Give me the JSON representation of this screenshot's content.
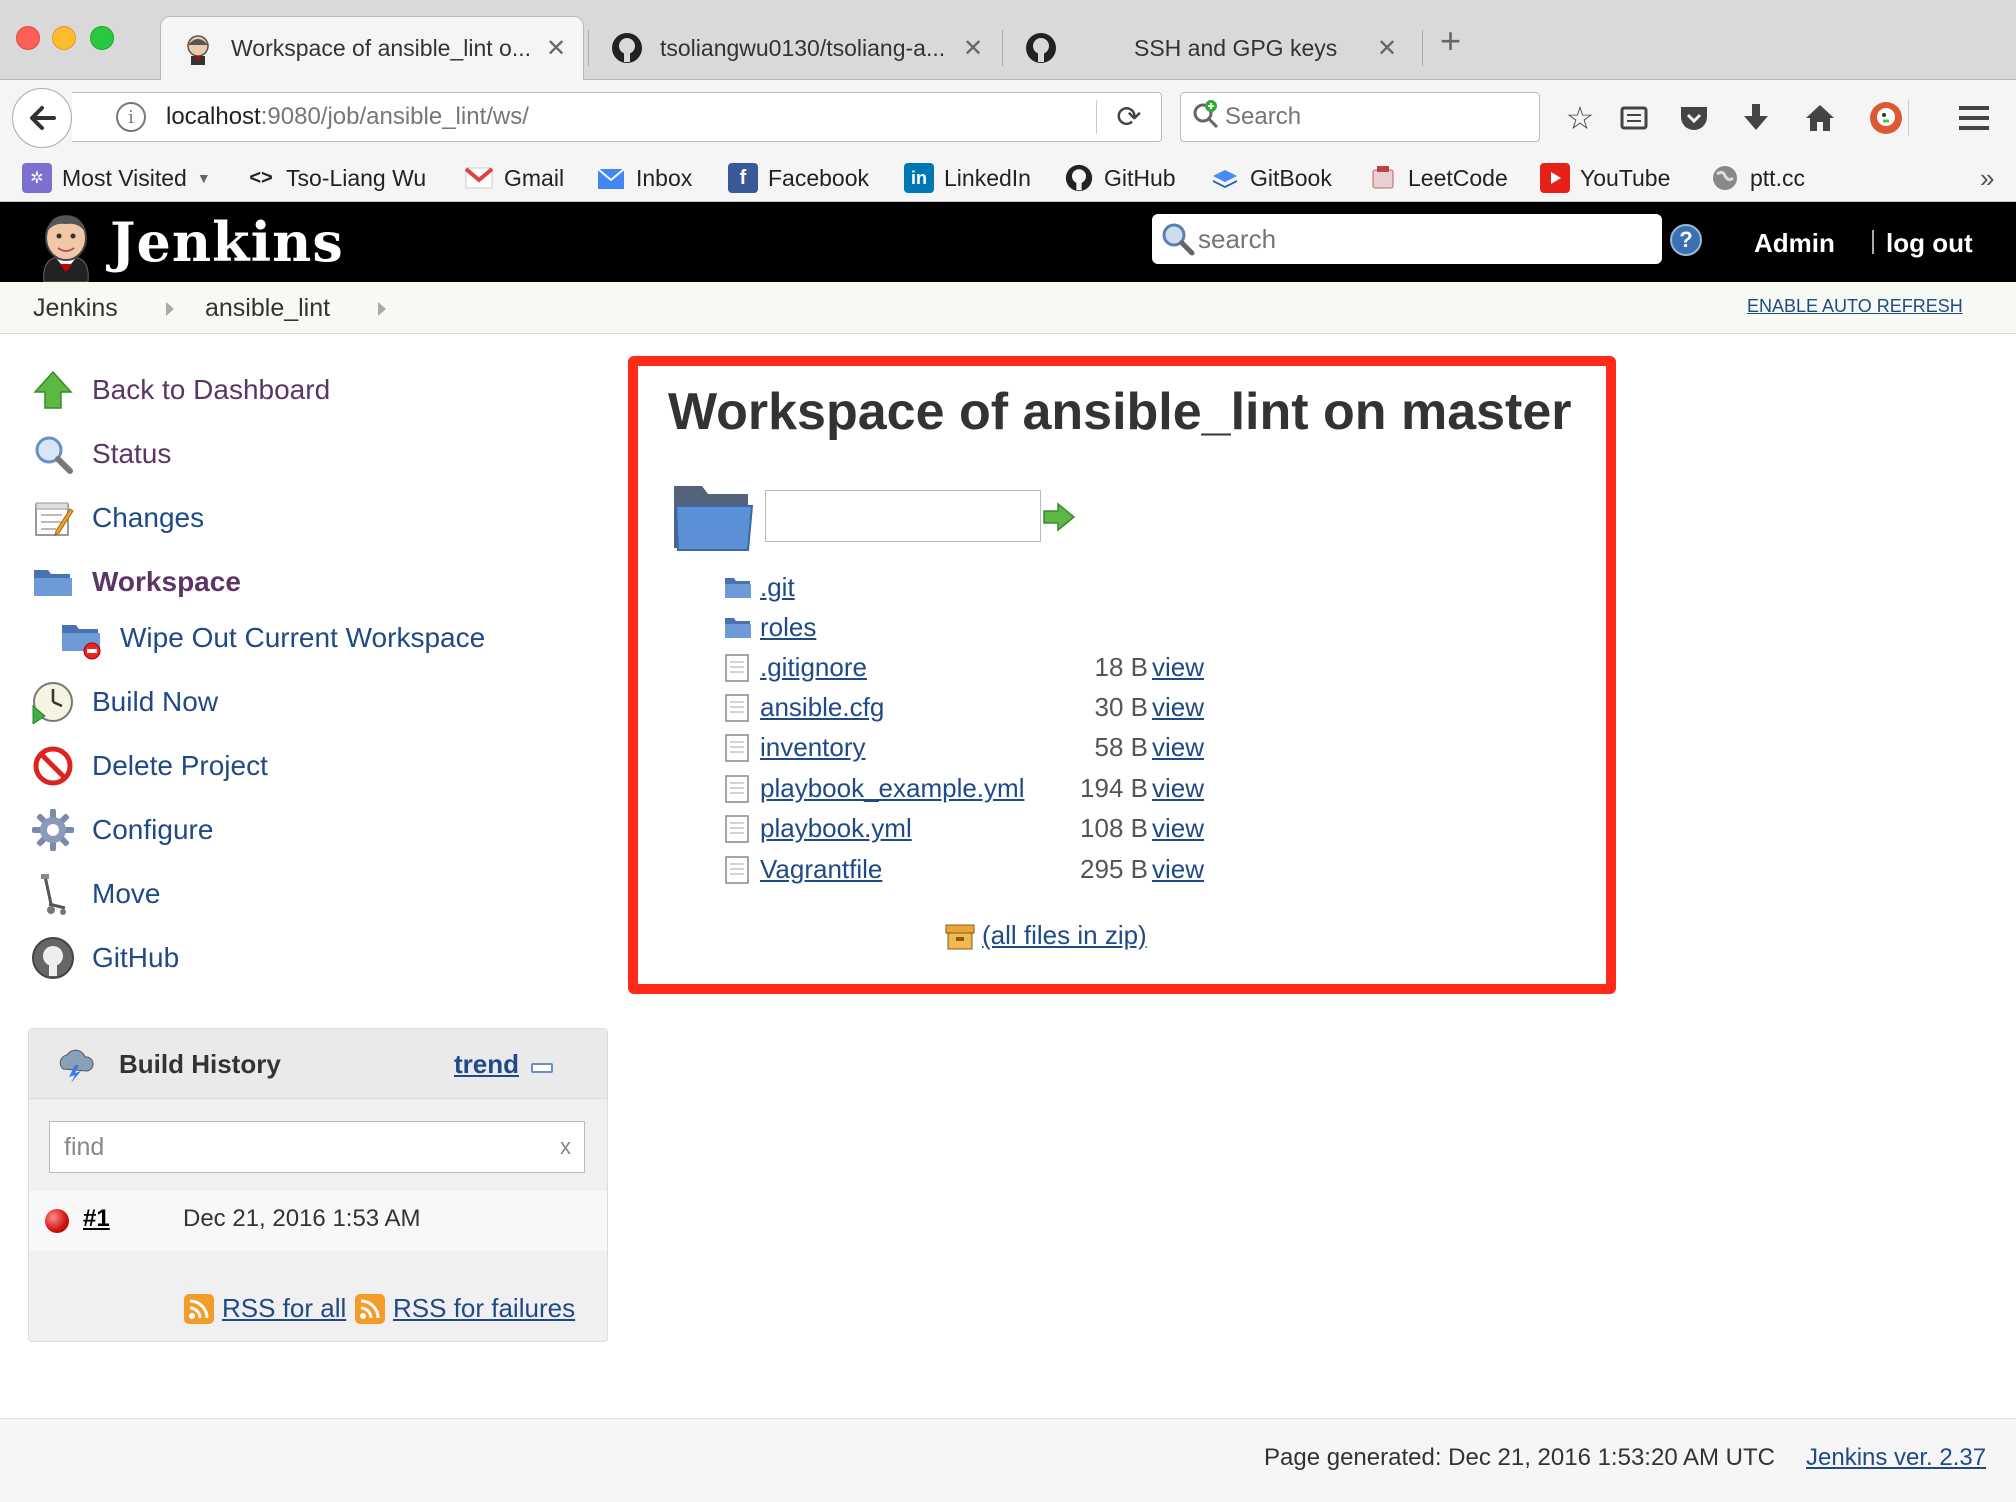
{
  "browser": {
    "tabs": [
      {
        "title": "Workspace of ansible_lint o...",
        "close": "✕",
        "favicon": "jenkins-icon"
      },
      {
        "title": "tsoliangwu0130/tsoliang-a...",
        "close": "✕",
        "favicon": "github-icon"
      },
      {
        "title": "SSH and GPG keys",
        "close": "✕",
        "favicon": "github-icon"
      }
    ],
    "new_tab": "+",
    "url_host": "localhost",
    "url_path": ":9080/job/ansible_lint/ws/",
    "search_placeholder": "Search",
    "bookmarks": [
      {
        "label": "Most Visited",
        "icon": "most-visited-icon"
      },
      {
        "label": "Tso-Liang Wu",
        "icon": "code-icon"
      },
      {
        "label": "Gmail",
        "icon": "gmail-icon"
      },
      {
        "label": "Inbox",
        "icon": "inbox-icon"
      },
      {
        "label": "Facebook",
        "icon": "facebook-icon"
      },
      {
        "label": "LinkedIn",
        "icon": "linkedin-icon"
      },
      {
        "label": "GitHub",
        "icon": "github-icon"
      },
      {
        "label": "GitBook",
        "icon": "gitbook-icon"
      },
      {
        "label": "LeetCode",
        "icon": "leetcode-icon"
      },
      {
        "label": "YouTube",
        "icon": "youtube-icon"
      },
      {
        "label": "ptt.cc",
        "icon": "globe-icon"
      }
    ]
  },
  "jenkins": {
    "title": "Jenkins",
    "search_placeholder": "search",
    "help": "?",
    "user": "Admin",
    "logout": "log out",
    "breadcrumbs": [
      "Jenkins",
      "ansible_lint"
    ],
    "auto_refresh": "ENABLE AUTO REFRESH"
  },
  "sidepanel": {
    "tasks": [
      {
        "label": "Back to Dashboard",
        "icon": "up-arrow-icon"
      },
      {
        "label": "Status",
        "icon": "magnifier-icon"
      },
      {
        "label": "Changes",
        "icon": "notepad-icon"
      },
      {
        "label": "Workspace",
        "icon": "folder-icon"
      },
      {
        "label": "Wipe Out Current Workspace",
        "icon": "wipe-icon"
      },
      {
        "label": "Build Now",
        "icon": "clock-icon"
      },
      {
        "label": "Delete Project",
        "icon": "no-entry-icon"
      },
      {
        "label": "Configure",
        "icon": "gear-icon"
      },
      {
        "label": "Move",
        "icon": "move-icon"
      },
      {
        "label": "GitHub",
        "icon": "github-icon"
      }
    ]
  },
  "build_history": {
    "title": "Build History",
    "trend": "trend",
    "find_value": "find",
    "clear": "x",
    "builds": [
      {
        "number": "#1",
        "date": "Dec 21, 2016 1:53 AM",
        "status_color": "#d01010"
      }
    ],
    "rss_all": "RSS for all",
    "rss_failures": "RSS for failures"
  },
  "main": {
    "title": "Workspace of ansible_lint on master",
    "files": [
      {
        "name": ".git",
        "type": "folder",
        "size": "",
        "view": ""
      },
      {
        "name": "roles",
        "type": "folder",
        "size": "",
        "view": ""
      },
      {
        "name": ".gitignore",
        "type": "file",
        "size": "18 B",
        "view": "view"
      },
      {
        "name": "ansible.cfg",
        "type": "file",
        "size": "30 B",
        "view": "view"
      },
      {
        "name": "inventory",
        "type": "file",
        "size": "58 B",
        "view": "view"
      },
      {
        "name": "playbook_example.yml",
        "type": "file",
        "size": "194 B",
        "view": "view"
      },
      {
        "name": "playbook.yml",
        "type": "file",
        "size": "108 B",
        "view": "view"
      },
      {
        "name": "Vagrantfile",
        "type": "file",
        "size": "295 B",
        "view": "view"
      }
    ],
    "zip_label": "(all files in zip)",
    "highlight_color": "#ff2a17"
  },
  "footer": {
    "generated": "Page generated: Dec 21, 2016 1:53:20 AM UTC",
    "version": "Jenkins ver. 2.37"
  }
}
